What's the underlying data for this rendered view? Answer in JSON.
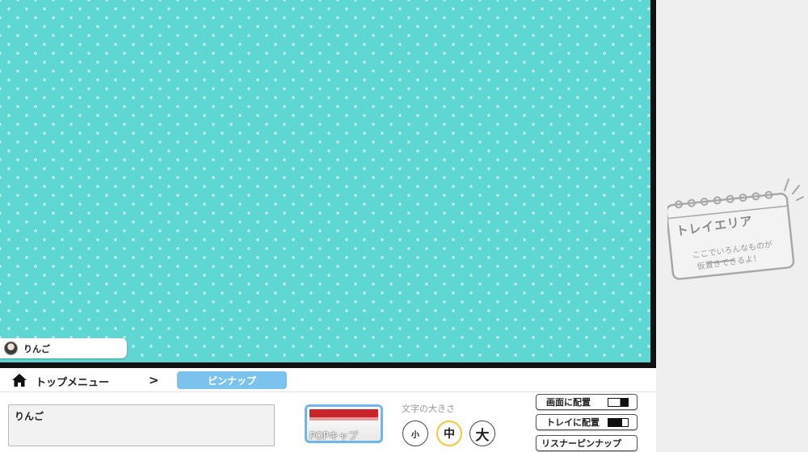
{
  "stage": {
    "background_color": "#5ed6d2",
    "user_tag": {
      "name": "りんご",
      "avatar": "avatar-icon"
    }
  },
  "tray": {
    "title": "トレイエリア",
    "subtitle_line1": "ここでいろんなものが",
    "subtitle_line2": "仮置きできるよ！",
    "icon": "notepad-icon"
  },
  "breadcrumb": {
    "home_icon": "home-icon",
    "top_label": "トップメニュー",
    "separator": ">",
    "current_label": "ピンナップ",
    "current_color": "#7cc2ef"
  },
  "controls": {
    "text_value": "りんご",
    "style_button_label": "POPキャプ",
    "size_label": "文字の大きさ",
    "size_options": [
      "小",
      "中",
      "大"
    ],
    "selected_size": "中",
    "selected_color": "#f3c83a",
    "actions": {
      "place_screen": "画面に配置",
      "place_tray": "トレイに配置",
      "listener_pinup": "リスナーピンナップ"
    }
  }
}
